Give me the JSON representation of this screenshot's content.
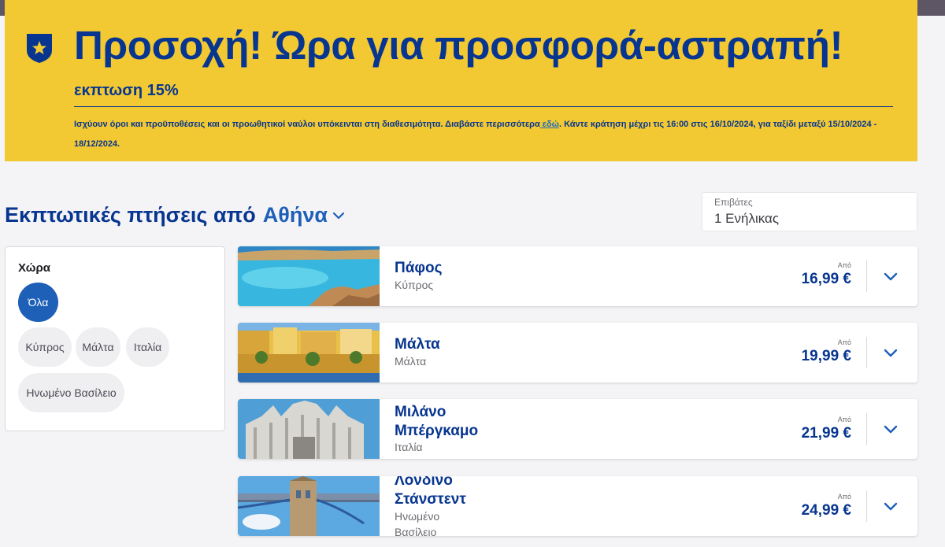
{
  "promo": {
    "title": "Προσοχή! Ώρα για προσφορά-αστραπή!",
    "subtitle": "εκπτωση 15%",
    "terms_before_link": "Ισχύουν όροι και προϋποθέσεις και οι προωθητικοί ναύλοι υπόκεινται στη διαθεσιμότητα. Διαβάστε περισσότερα",
    "terms_link": " εδώ",
    "terms_after_link": ". Κάντε κράτηση μέχρι τις 16:00 στις 16/10/2024, για ταξίδι μεταξύ 15/10/2024 - 18/12/2024.",
    "icon": "star-shield-icon"
  },
  "heading": {
    "text": "Εκπτωτικές πτήσεις από",
    "city": "Αθήνα",
    "icon": "chevron-down-icon"
  },
  "passengers": {
    "label": "Επιβάτες",
    "value": "1 Ενήλικας"
  },
  "filter": {
    "title": "Χώρα",
    "chips": [
      {
        "label": "Όλα",
        "active": true
      },
      {
        "label": "Κύπρος",
        "active": false
      },
      {
        "label": "Μάλτα",
        "active": false
      },
      {
        "label": "Ιταλία",
        "active": false
      },
      {
        "label": "Ηνωμένο Βασίλειο",
        "active": false
      }
    ]
  },
  "flights": [
    {
      "destination_lines": [
        "Πάφος"
      ],
      "country_lines": [
        "Κύπρος"
      ],
      "from_label": "Από",
      "price": "16,99 €"
    },
    {
      "destination_lines": [
        "Μάλτα"
      ],
      "country_lines": [
        "Μάλτα"
      ],
      "from_label": "Από",
      "price": "19,99 €"
    },
    {
      "destination_lines": [
        "Μιλάνο",
        "Μπέργκαμο"
      ],
      "country_lines": [
        "Ιταλία"
      ],
      "from_label": "Από",
      "price": "21,99 €"
    },
    {
      "destination_lines": [
        "Λονδίνο",
        "Στάνστεντ"
      ],
      "country_lines": [
        "Ηνωμένο",
        "Βασίλειο"
      ],
      "from_label": "Από",
      "price": "24,99 €"
    }
  ],
  "colors": {
    "promo_background": "#f2c932",
    "brand_navy": "#073590",
    "accent_blue": "#1e5fb8"
  }
}
